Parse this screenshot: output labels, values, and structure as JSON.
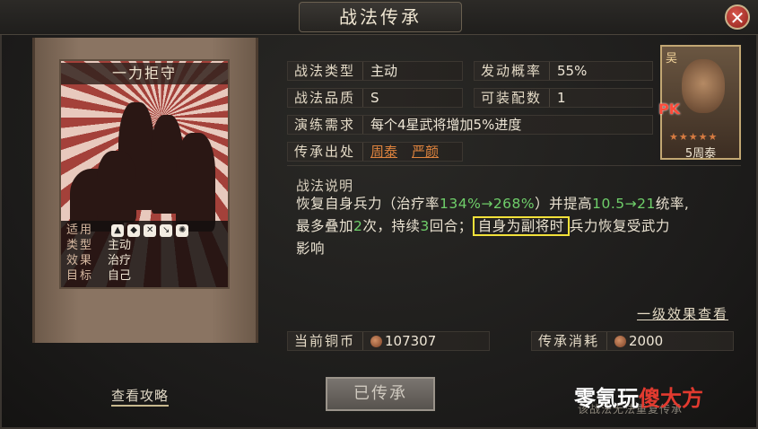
{
  "window": {
    "title": "战法传承",
    "close_label": "✕"
  },
  "card": {
    "name": "一力拒守",
    "rows": [
      {
        "key": "适用",
        "value": ""
      },
      {
        "key": "类型",
        "value": "主动"
      },
      {
        "key": "效果",
        "value": "治疗"
      },
      {
        "key": "目标",
        "value": "自己"
      }
    ],
    "applicable_icons": [
      "cavalry-icon",
      "shield-icon",
      "bow-icon",
      "spear-icon",
      "wheel-icon"
    ]
  },
  "attributes": {
    "type_label": "战法类型",
    "type_value": "主动",
    "rate_label": "发动概率",
    "rate_value": "55%",
    "quality_label": "战法品质",
    "quality_value": "S",
    "equip_label": "可装配数",
    "equip_value": "1",
    "train_label": "演练需求",
    "train_value": "每个4星武将增加5%进度",
    "source_label": "传承出处",
    "source_links": [
      "周泰",
      "严颜"
    ]
  },
  "description": {
    "title": "战法说明",
    "p1": "恢复自身兵力（治疗率",
    "heal_rate": "134%→268%",
    "p2": "）并提高",
    "stat_gain": "10.5→21",
    "p3": "统率,",
    "p4": "最多叠加",
    "stack": "2",
    "p5": "次，持续",
    "duration": "3",
    "p6": "回合；",
    "highlight": "自身为副将时",
    "p7": "兵力恢复受武力",
    "p8": "影响"
  },
  "effect_link": "一级效果查看",
  "costs": {
    "copper_label": "当前铜币",
    "copper_value": "107307",
    "inherit_label": "传承消耗",
    "inherit_value": "2000"
  },
  "buttons": {
    "main": "已传承",
    "guide": "查看攻略"
  },
  "portrait": {
    "kingdom": "吴",
    "badge": "PK",
    "stars": "★★★★★",
    "label": "5周泰"
  },
  "watermark": {
    "text_a": "零氪玩",
    "text_b": "傻大方",
    "sub": "该战法无法重复传承"
  },
  "colors": {
    "accent_orange": "#e0843e",
    "green_value": "#6fcf6a",
    "highlight_box": "#f2e13a"
  }
}
